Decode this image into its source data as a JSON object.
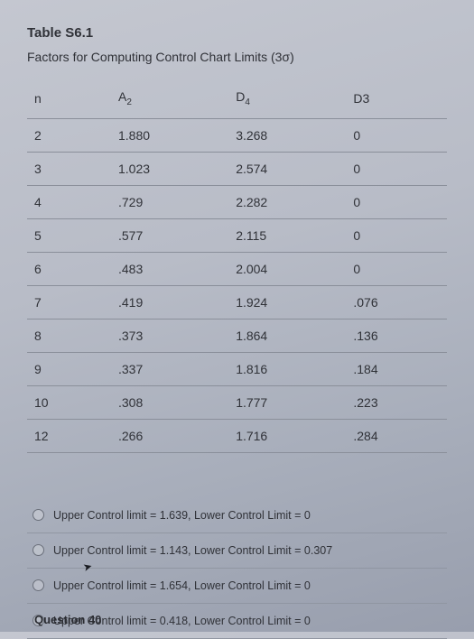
{
  "title": "Table S6.1",
  "subtitle": "Factors for Computing Control Chart Limits (3σ)",
  "headers": {
    "n": "n",
    "a2": "A",
    "a2_sub": "2",
    "d4": "D",
    "d4_sub": "4",
    "d3": "D3"
  },
  "chart_data": {
    "type": "table",
    "title": "Factors for Computing Control Chart Limits (3σ)",
    "columns": [
      "n",
      "A2",
      "D4",
      "D3"
    ],
    "rows": [
      {
        "n": "2",
        "a2": "1.880",
        "d4": "3.268",
        "d3": "0"
      },
      {
        "n": "3",
        "a2": "1.023",
        "d4": "2.574",
        "d3": "0"
      },
      {
        "n": "4",
        "a2": ".729",
        "d4": "2.282",
        "d3": "0"
      },
      {
        "n": "5",
        "a2": ".577",
        "d4": "2.115",
        "d3": "0"
      },
      {
        "n": "6",
        "a2": ".483",
        "d4": "2.004",
        "d3": "0"
      },
      {
        "n": "7",
        "a2": ".419",
        "d4": "1.924",
        "d3": ".076"
      },
      {
        "n": "8",
        "a2": ".373",
        "d4": "1.864",
        "d3": ".136"
      },
      {
        "n": "9",
        "a2": ".337",
        "d4": "1.816",
        "d3": ".184"
      },
      {
        "n": "10",
        "a2": ".308",
        "d4": "1.777",
        "d3": ".223"
      },
      {
        "n": "12",
        "a2": ".266",
        "d4": "1.716",
        "d3": ".284"
      }
    ]
  },
  "options": [
    "Upper Control limit = 1.639, Lower Control Limit = 0",
    "Upper Control limit = 1.143, Lower Control Limit = 0.307",
    "Upper Control limit = 1.654, Lower Control Limit = 0",
    "Upper Control limit = 0.418, Lower Control Limit = 0"
  ],
  "footer_partial": "Question 40"
}
